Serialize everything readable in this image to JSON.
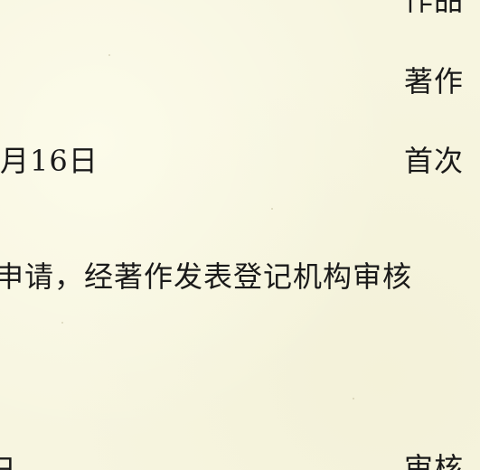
{
  "certificate": {
    "right_column": {
      "work_label_partial": "作品",
      "author_label_partial": "著作",
      "first_publish_label_partial": "首次",
      "review_label_partial": "审核"
    },
    "left_column": {
      "date_fragment": "月16日",
      "bottom_fragment": "日"
    },
    "body_sentence_partial": "申请，经著作发表登记机构审核"
  }
}
